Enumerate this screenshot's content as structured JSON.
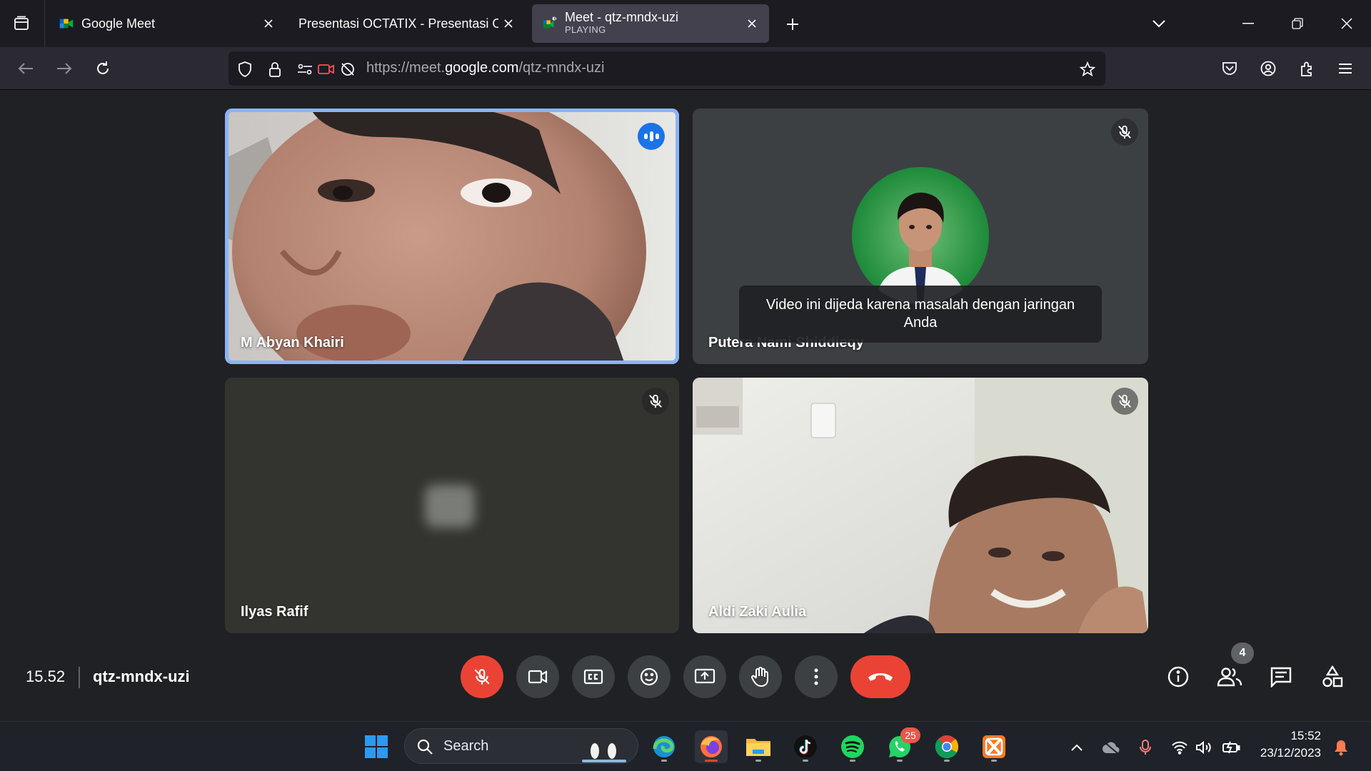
{
  "browser": {
    "tabs": [
      {
        "title": "Google Meet",
        "active": false
      },
      {
        "title": "Presentasi OCTATIX - Presentasi OC",
        "active": false
      },
      {
        "title": "Meet - qtz-mndx-uzi",
        "subtitle": "PLAYING",
        "active": true
      }
    ],
    "url": {
      "prefix": "https://meet.",
      "host": "google.com",
      "path": "/qtz-mndx-uzi"
    }
  },
  "meet": {
    "participants": [
      {
        "name": "M Abyan Khairi",
        "speaking": true,
        "muted": false
      },
      {
        "name": "Putera Nami Shiddieqy",
        "speaking": false,
        "muted": true
      },
      {
        "name": "Ilyas Rafif",
        "speaking": false,
        "muted": true
      },
      {
        "name": "Aldi Zaki Aulia",
        "speaking": false,
        "muted": true
      }
    ],
    "paused_notice": "Video ini dijeda karena masalah dengan jaringan Anda",
    "time": "15.52",
    "meeting_code": "qtz-mndx-uzi",
    "people_count": "4",
    "colors": {
      "accent": "#8ab4f8",
      "danger": "#ea4335",
      "control_bg": "#3c4043"
    }
  },
  "taskbar": {
    "search_placeholder": "Search",
    "whatsapp_badge": "25",
    "clock_time": "15:52",
    "clock_date": "23/12/2023"
  }
}
